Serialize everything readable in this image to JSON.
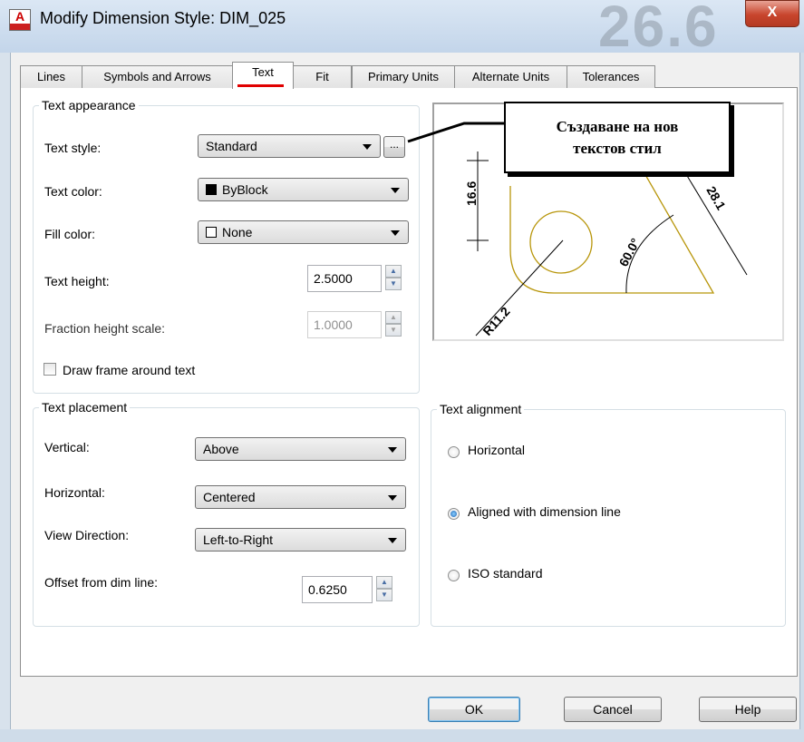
{
  "window": {
    "title": "Modify Dimension Style: DIM_025",
    "close_glyph": "X",
    "background_digits": "26.6"
  },
  "tabs": [
    {
      "label": "Lines"
    },
    {
      "label": "Symbols and Arrows"
    },
    {
      "label": "Text"
    },
    {
      "label": "Fit"
    },
    {
      "label": "Primary Units"
    },
    {
      "label": "Alternate Units"
    },
    {
      "label": "Tolerances"
    }
  ],
  "text_appearance": {
    "legend": "Text appearance",
    "text_style_label": "Text style:",
    "text_style_value": "Standard",
    "browse_label": "...",
    "text_color_label": "Text color:",
    "text_color_value": "ByBlock",
    "fill_color_label": "Fill color:",
    "fill_color_value": "None",
    "text_height_label": "Text height:",
    "text_height_value": "2.5000",
    "fraction_label": "Fraction height scale:",
    "fraction_value": "1.0000",
    "draw_frame_label": "Draw frame around text"
  },
  "text_placement": {
    "legend": "Text placement",
    "vertical_label": "Vertical:",
    "vertical_value": "Above",
    "horizontal_label": "Horizontal:",
    "horizontal_value": "Centered",
    "view_direction_label": "View Direction:",
    "view_direction_value": "Left-to-Right",
    "offset_label": "Offset from dim line:",
    "offset_value": "0.6250"
  },
  "text_alignment": {
    "legend": "Text alignment",
    "options": [
      "Horizontal",
      "Aligned with dimension line",
      "ISO standard"
    ],
    "selected": "Aligned with dimension line"
  },
  "preview": {
    "dim_vertical": "16.6",
    "dim_slanted": "28.1",
    "dim_angle": "60.0°",
    "dim_radius": "R11.2"
  },
  "annotation": {
    "line1": "Създаване на нов",
    "line2": "текстов стил"
  },
  "buttons": {
    "ok": "OK",
    "cancel": "Cancel",
    "help": "Help"
  },
  "colors": {
    "accent_red": "#e00000",
    "preview_geometry": "#b8960b",
    "text_color_swatch": "#000000"
  }
}
